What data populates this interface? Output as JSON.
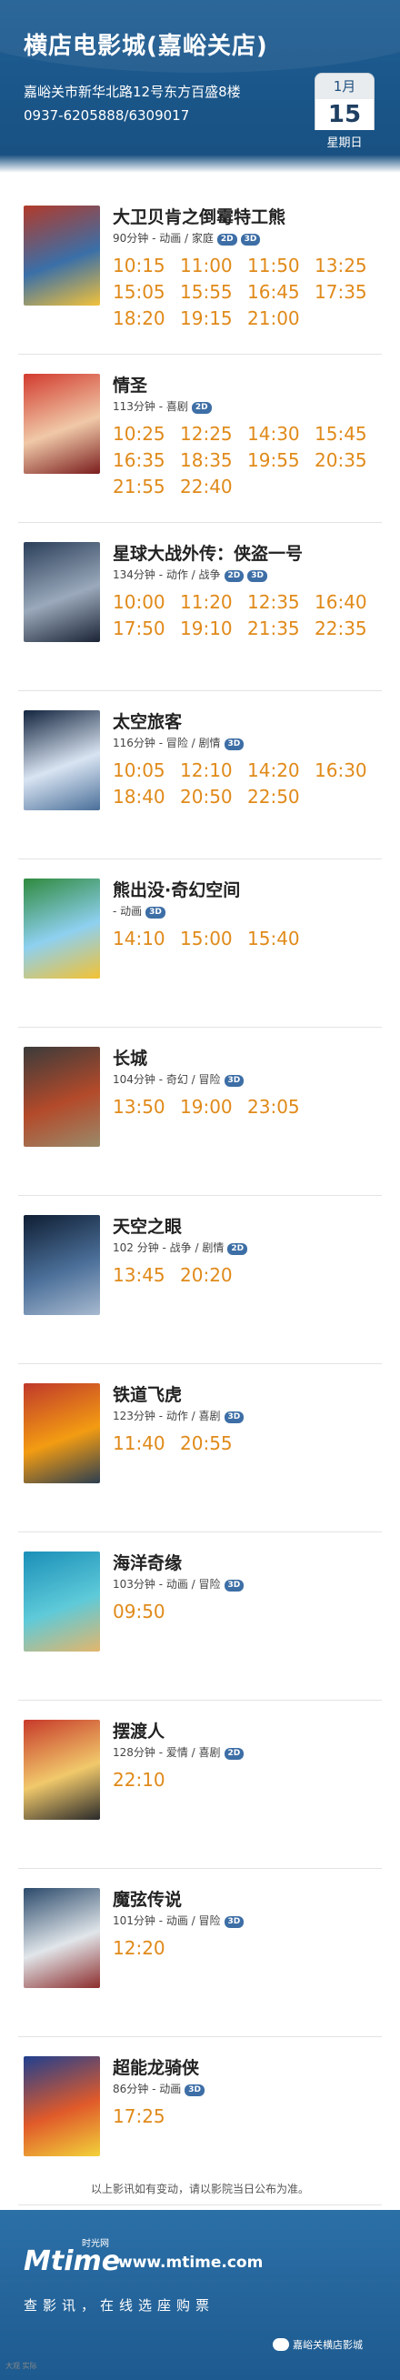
{
  "header": {
    "cinema_name": "横店电影城(嘉峪关店)",
    "address": "嘉峪关市新华北路12号东方百盛8楼",
    "phone": "0937-6205888/6309017",
    "date": {
      "month": "1月",
      "day": "15",
      "weekday": "星期日"
    }
  },
  "movies": [
    {
      "title": "大卫贝肯之倒霉特工熊",
      "meta": "90分钟 - 动画 / 家庭",
      "formats": [
        "2D",
        "3D"
      ],
      "times": [
        "10:15",
        "11:00",
        "11:50",
        "13:25",
        "15:05",
        "15:55",
        "16:45",
        "17:35",
        "18:20",
        "19:15",
        "21:00"
      ],
      "poster_colors": [
        "#b23a2a",
        "#3a6fa8",
        "#f2c23a"
      ]
    },
    {
      "title": "情圣",
      "meta": "113分钟 - 喜剧",
      "formats": [
        "2D"
      ],
      "times": [
        "10:25",
        "12:25",
        "14:30",
        "15:45",
        "16:35",
        "18:35",
        "19:55",
        "20:35",
        "21:55",
        "22:40"
      ],
      "poster_colors": [
        "#d23b2e",
        "#f0c9a8",
        "#7a1d1d"
      ]
    },
    {
      "title": "星球大战外传：侠盗一号",
      "meta": "134分钟 - 动作 / 战争",
      "formats": [
        "2D",
        "3D"
      ],
      "times": [
        "10:00",
        "11:20",
        "12:35",
        "16:40",
        "17:50",
        "19:10",
        "21:35",
        "22:35"
      ],
      "poster_colors": [
        "#2b3f5a",
        "#9aa9bb",
        "#1a2435"
      ]
    },
    {
      "title": "太空旅客",
      "meta": "116分钟 - 冒险 / 剧情",
      "formats": [
        "3D"
      ],
      "times": [
        "10:05",
        "12:10",
        "14:20",
        "16:30",
        "18:40",
        "20:50",
        "22:50"
      ],
      "poster_colors": [
        "#12243e",
        "#d9e4f2",
        "#4a6f99"
      ]
    },
    {
      "title": "熊出没·奇幻空间",
      "meta": "- 动画",
      "formats": [
        "3D"
      ],
      "times": [
        "14:10",
        "15:00",
        "15:40"
      ],
      "poster_colors": [
        "#2f8a3e",
        "#8ed0f0",
        "#f3c233"
      ]
    },
    {
      "title": "长城",
      "meta": "104分钟 - 奇幻 / 冒险",
      "formats": [
        "3D"
      ],
      "times": [
        "13:50",
        "19:00",
        "23:05"
      ],
      "poster_colors": [
        "#3b3b3b",
        "#b34a2a",
        "#9a8a6a"
      ]
    },
    {
      "title": "天空之眼",
      "meta": "102 分钟 - 战争 / 剧情",
      "formats": [
        "2D"
      ],
      "times": [
        "13:45",
        "20:20"
      ],
      "poster_colors": [
        "#0f1e33",
        "#4b6f99",
        "#a7b9cf"
      ]
    },
    {
      "title": "铁道飞虎",
      "meta": "123分钟 - 动作 / 喜剧",
      "formats": [
        "3D"
      ],
      "times": [
        "11:40",
        "20:55"
      ],
      "poster_colors": [
        "#c0392b",
        "#f39c12",
        "#2c3e50"
      ]
    },
    {
      "title": "海洋奇缘",
      "meta": "103分钟 - 动画 / 冒险",
      "formats": [
        "3D"
      ],
      "times": [
        "09:50"
      ],
      "poster_colors": [
        "#1a8fb8",
        "#5ecad9",
        "#e3b66b"
      ]
    },
    {
      "title": "摆渡人",
      "meta": "128分钟 - 爱情 / 喜剧",
      "formats": [
        "2D"
      ],
      "times": [
        "22:10"
      ],
      "poster_colors": [
        "#c73a2a",
        "#f1c96b",
        "#2a2a2a"
      ]
    },
    {
      "title": "魔弦传说",
      "meta": "101分钟 - 动画 / 冒险",
      "formats": [
        "3D"
      ],
      "times": [
        "12:20"
      ],
      "poster_colors": [
        "#2b4a6b",
        "#e1e6ea",
        "#8c2d2d"
      ]
    },
    {
      "title": "超能龙骑侠",
      "meta": "86分钟 - 动画",
      "formats": [
        "3D"
      ],
      "times": [
        "17:25"
      ],
      "poster_colors": [
        "#1f3f8f",
        "#e05a2a",
        "#f2d23a"
      ]
    }
  ],
  "notice": "以上影讯如有变动，请以影院当日公布为准。",
  "footer": {
    "logo": "Mtime",
    "logo_sub": "时光网",
    "site": "www.mtime.com",
    "slogan": "查影讯，在线选座购票",
    "wechat": "嘉峪关横店影城"
  },
  "watermark": "大观 实际"
}
